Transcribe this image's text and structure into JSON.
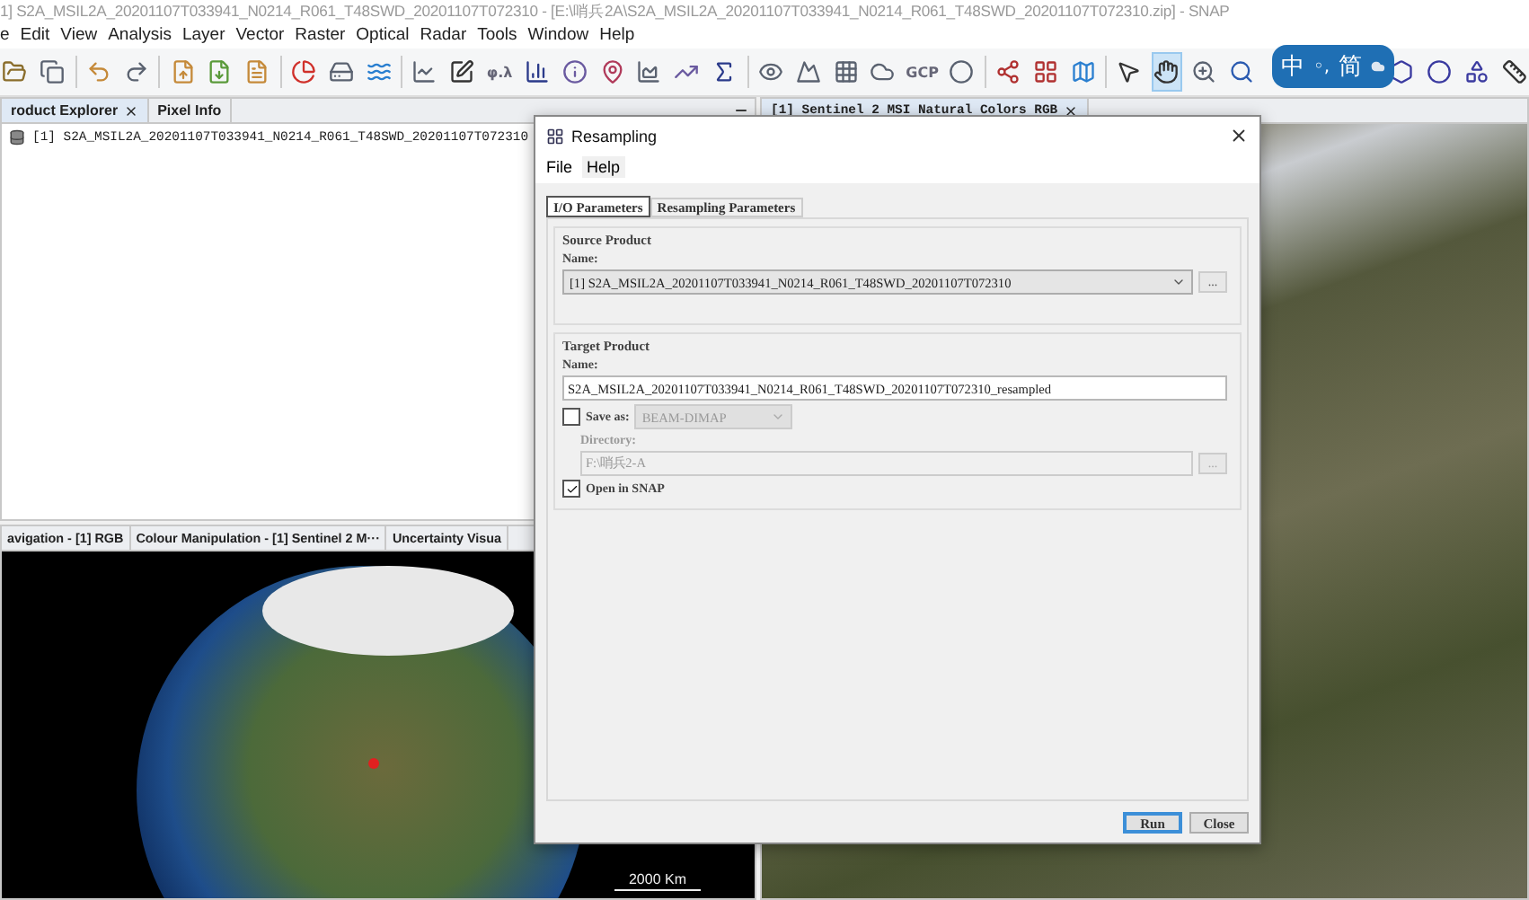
{
  "window": {
    "title": "1] S2A_MSIL2A_20201107T033941_N0214_R061_T48SWD_20201107T072310 - [E:\\哨兵2A\\S2A_MSIL2A_20201107T033941_N0214_R061_T48SWD_20201107T072310.zip] - SNAP"
  },
  "menu": [
    "e",
    "Edit",
    "View",
    "Analysis",
    "Layer",
    "Vector",
    "Raster",
    "Optical",
    "Radar",
    "Tools",
    "Window",
    "Help"
  ],
  "toolbar": {
    "geo_label": "φ.λ",
    "gcp_label": "GCP",
    "pan_selected": true
  },
  "ime": {
    "mode": "中",
    "punct": "◦,",
    "script": "简"
  },
  "explorer_panel": {
    "tabs": [
      {
        "label": "roduct Explorer",
        "selected": true,
        "closable": true
      },
      {
        "label": "Pixel Info",
        "selected": false,
        "closable": false
      }
    ],
    "tree": [
      {
        "label": "[1] S2A_MSIL2A_20201107T033941_N0214_R061_T48SWD_20201107T072310"
      }
    ]
  },
  "tool_panel": {
    "tabs": [
      "avigation - [1] RGB",
      "Colour Manipulation - [1] Sentinel 2 M···",
      "Uncertainty Visua"
    ],
    "scale_label": "2000 Km"
  },
  "image_view": {
    "tab": "[1] Sentinel 2 MSI Natural Colors RGB"
  },
  "dialog": {
    "title": "Resampling",
    "menu": [
      "File",
      "Help"
    ],
    "tabs": [
      {
        "label": "I/O Parameters",
        "selected": true
      },
      {
        "label": "Resampling Parameters",
        "selected": false
      }
    ],
    "source": {
      "heading": "Source Product",
      "name_label": "Name:",
      "value": "[1] S2A_MSIL2A_20201107T033941_N0214_R061_T48SWD_20201107T072310",
      "browse": "..."
    },
    "target": {
      "heading": "Target Product",
      "name_label": "Name:",
      "value": "S2A_MSIL2A_20201107T033941_N0214_R061_T48SWD_20201107T072310_resampled",
      "save_as": {
        "label": "Save as:",
        "checked": false,
        "format": "BEAM-DIMAP"
      },
      "directory": {
        "label": "Directory:",
        "value": "F:\\哨兵2-A",
        "browse": "...",
        "disabled": true
      },
      "open_in_snap": {
        "label": "Open in SNAP",
        "checked": true
      }
    },
    "buttons": [
      {
        "label": "Run",
        "default": true
      },
      {
        "label": "Close",
        "default": false
      }
    ]
  }
}
